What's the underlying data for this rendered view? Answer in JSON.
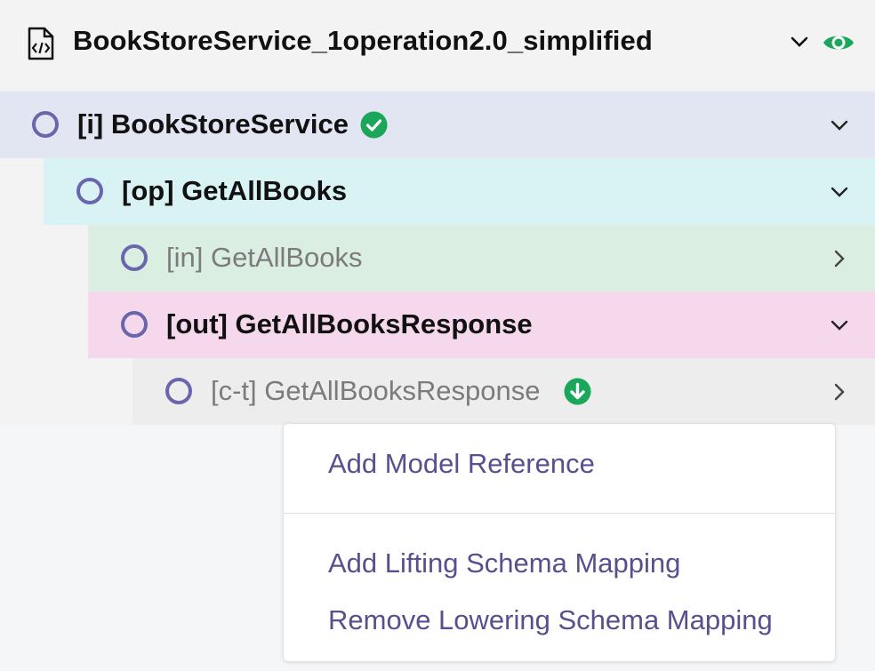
{
  "header": {
    "title": "BookStoreService_1operation2.0_simplified",
    "file_icon": "code-file-icon",
    "expand_icon": "chevron-down-icon",
    "visibility_icon": "eye-icon"
  },
  "tree": {
    "rows": [
      {
        "label": "[i] BookStoreService",
        "state": "expanded",
        "badge": "check-circle-icon"
      },
      {
        "label": "[op] GetAllBooks",
        "state": "expanded"
      },
      {
        "label": "[in] GetAllBooks",
        "state": "collapsed"
      },
      {
        "label": "[out] GetAllBooksResponse",
        "state": "expanded"
      },
      {
        "label": "[c-t] GetAllBooksResponse",
        "state": "collapsed",
        "badge": "arrow-down-circle-icon"
      }
    ]
  },
  "context_menu": {
    "items": [
      {
        "label": "Add Model Reference"
      },
      {
        "label": "Add Lifting Schema Mapping"
      },
      {
        "label": "Remove Lowering Schema Mapping"
      }
    ]
  },
  "colors": {
    "accent": "#6a66ad",
    "menu_text": "#57508f",
    "success": "#1aa75a",
    "row_interface": "#e2e6f2",
    "row_operation": "#d9f3f4",
    "row_input": "#dbeee2",
    "row_output": "#f5d8ec",
    "row_complex_type": "#ededed"
  }
}
